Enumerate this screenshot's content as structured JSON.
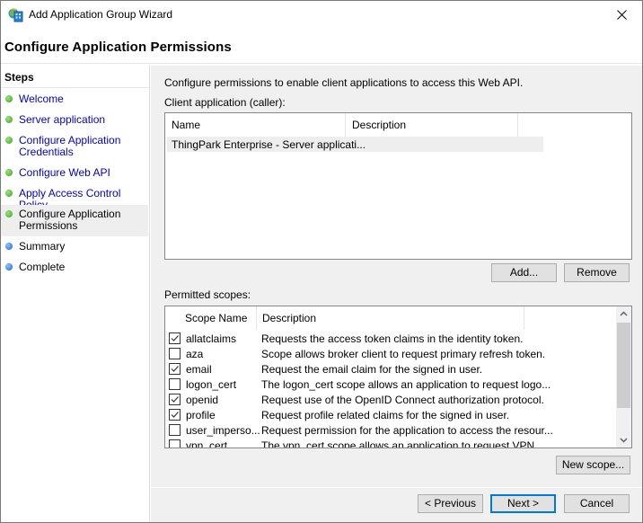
{
  "window": {
    "title": "Add Application Group Wizard",
    "icon": "app-group-wizard-icon",
    "close_icon": "close-icon"
  },
  "header": {
    "title": "Configure Application Permissions"
  },
  "steps": {
    "title": "Steps",
    "items": [
      {
        "label": "Welcome",
        "status": "done",
        "link": true
      },
      {
        "label": "Server application",
        "status": "done",
        "link": true
      },
      {
        "label": "Configure Application Credentials",
        "status": "done",
        "link": true
      },
      {
        "label": "Configure Web API",
        "status": "done",
        "link": true
      },
      {
        "label": "Apply Access Control Policy",
        "status": "done",
        "link": true
      },
      {
        "label": "Configure Application Permissions",
        "status": "current",
        "link": false
      },
      {
        "label": "Summary",
        "status": "pending",
        "link": false
      },
      {
        "label": "Complete",
        "status": "pending",
        "link": false
      }
    ]
  },
  "main": {
    "intro": "Configure permissions to enable client applications to access this Web API.",
    "client_label": "Client application (caller):",
    "client_columns": [
      "Name",
      "Description"
    ],
    "client_rows": [
      {
        "name": "ThingPark Enterprise - Server applicati...",
        "description": ""
      }
    ],
    "add_label": "Add...",
    "remove_label": "Remove",
    "scopes_label": "Permitted scopes:",
    "scope_columns": [
      "Scope Name",
      "Description"
    ],
    "scopes": [
      {
        "name": "allatclaims",
        "description": "Requests the access token claims in the identity token.",
        "checked": true
      },
      {
        "name": "aza",
        "description": "Scope allows broker client to request primary refresh token.",
        "checked": false
      },
      {
        "name": "email",
        "description": "Request the email claim for the signed in user.",
        "checked": true
      },
      {
        "name": "logon_cert",
        "description": "The logon_cert scope allows an application to request logo...",
        "checked": false
      },
      {
        "name": "openid",
        "description": "Request use of the OpenID Connect authorization protocol.",
        "checked": true
      },
      {
        "name": "profile",
        "description": "Request profile related claims for the signed in user.",
        "checked": true
      },
      {
        "name": "user_imperso...",
        "description": "Request permission for the application to access the resour...",
        "checked": false
      },
      {
        "name": "vpn_cert",
        "description": "The vpn_cert scope allows an application to request VPN ...",
        "checked": false
      }
    ],
    "new_scope_label": "New scope..."
  },
  "footer": {
    "previous_label": "< Previous",
    "next_label": "Next >",
    "cancel_label": "Cancel"
  },
  "colors": {
    "accent": "#0078d7",
    "link": "#0000cc",
    "step_done": "#3aa51a",
    "step_pending": "#1b64d8"
  }
}
